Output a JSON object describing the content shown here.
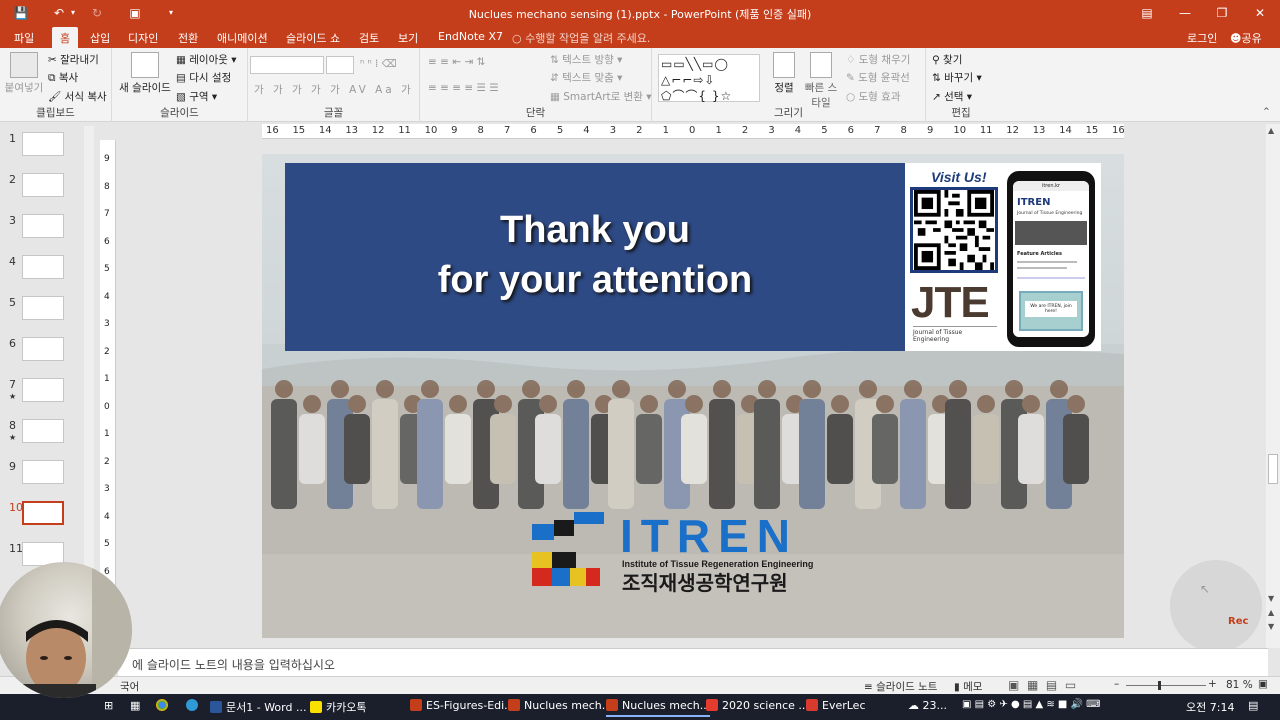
{
  "window": {
    "title": "Nuclues mechano sensing (1).pptx - PowerPoint (제품 인증 실패)",
    "accent": "#c43e1c"
  },
  "tabs": [
    "파일",
    "홈",
    "삽입",
    "디자인",
    "전환",
    "애니메이션",
    "슬라이드 쇼",
    "검토",
    "보기",
    "EndNote X7"
  ],
  "active_tab": "홈",
  "tell_me": "수행할 작업을 알려 주세요.",
  "login": "로그인",
  "share": "공유",
  "ribbon": {
    "clipboard": {
      "paste": "붙여넣기",
      "cut": "잘라내기",
      "copy": "복사",
      "format_painter": "서식 복사",
      "label": "클립보드"
    },
    "slides": {
      "new_slide": "새 슬라이드",
      "layout": "레이아웃",
      "reset": "다시 설정",
      "section": "구역",
      "label": "슬라이드"
    },
    "font": {
      "label": "글꼴",
      "bold": "가",
      "italic": "가",
      "underline": "가",
      "strike": "가",
      "shadow": "가",
      "spacing": "AV",
      "case": "Aa",
      "color": "가"
    },
    "paragraph": {
      "text_direction": "텍스트 방향",
      "align_text": "텍스트 맞춤",
      "smartart": "SmartArt로 변환",
      "label": "단락"
    },
    "drawing": {
      "arrange": "정렬",
      "quick_styles": "빠른 스타일",
      "shape_fill": "도형 채우기",
      "shape_outline": "도형 윤곽선",
      "shape_effects": "도형 효과",
      "label": "그리기"
    },
    "editing": {
      "find": "찾기",
      "replace": "바꾸기",
      "select": "선택",
      "label": "편집"
    }
  },
  "ruler_ticks": [
    "16",
    "15",
    "14",
    "13",
    "12",
    "11",
    "10",
    "9",
    "8",
    "7",
    "6",
    "5",
    "4",
    "3",
    "2",
    "1",
    "0",
    "1",
    "2",
    "3",
    "4",
    "5",
    "6",
    "7",
    "8",
    "9",
    "10",
    "11",
    "12",
    "13",
    "14",
    "15",
    "16"
  ],
  "vruler_ticks": [
    "9",
    "8",
    "7",
    "6",
    "5",
    "4",
    "3",
    "2",
    "1",
    "0",
    "1",
    "2",
    "3",
    "4",
    "5",
    "6",
    "7"
  ],
  "thumbnails": [
    {
      "num": "1",
      "star": ""
    },
    {
      "num": "2",
      "star": ""
    },
    {
      "num": "3",
      "star": ""
    },
    {
      "num": "4",
      "star": ""
    },
    {
      "num": "5",
      "star": ""
    },
    {
      "num": "6",
      "star": ""
    },
    {
      "num": "7",
      "star": "★"
    },
    {
      "num": "8",
      "star": "★"
    },
    {
      "num": "9",
      "star": ""
    },
    {
      "num": "10",
      "star": ""
    },
    {
      "num": "11",
      "star": ""
    }
  ],
  "active_slide": "10",
  "slide": {
    "line1": "Thank you",
    "line2": "for your attention",
    "visit": "Visit Us!",
    "jte": "JTE",
    "jte_sub": "Journal of Tissue Engineering",
    "phone_url": "itren.kr",
    "phone_brand": "ITREN",
    "phone_journal": "Journal of Tissue Engineering",
    "phone_feature": "Feature Articles",
    "phone_cta": "We are ITREN, join here!",
    "itren_name": "ITREN",
    "itren_en": "Institute of Tissue Regeneration Engineering",
    "itren_ko": "조직재생공학연구원"
  },
  "rec_label": "Rec",
  "notes_placeholder": "에 슬라이드 노트의 내용을 입력하십시오",
  "status": {
    "language": "국어",
    "notes": "슬라이드 노트",
    "comments": "메모",
    "zoom": "81 %",
    "zoom_level": 0.81
  },
  "taskbar": {
    "items": [
      {
        "label": "문서1 - Word ...",
        "color": "#2b579a"
      },
      {
        "label": "카카오톡",
        "color": "#f9e000"
      },
      {
        "label": "ES-Figures-Edi...",
        "color": "#c43e1c"
      },
      {
        "label": "Nuclues mech...",
        "color": "#c43e1c"
      },
      {
        "label": "Nuclues mech...",
        "color": "#c43e1c"
      },
      {
        "label": "2020 science ...",
        "color": "#e33b2e"
      },
      {
        "label": "EverLec",
        "color": "#d83b2e"
      }
    ],
    "weather": "23...",
    "time": "오전 7:14"
  }
}
